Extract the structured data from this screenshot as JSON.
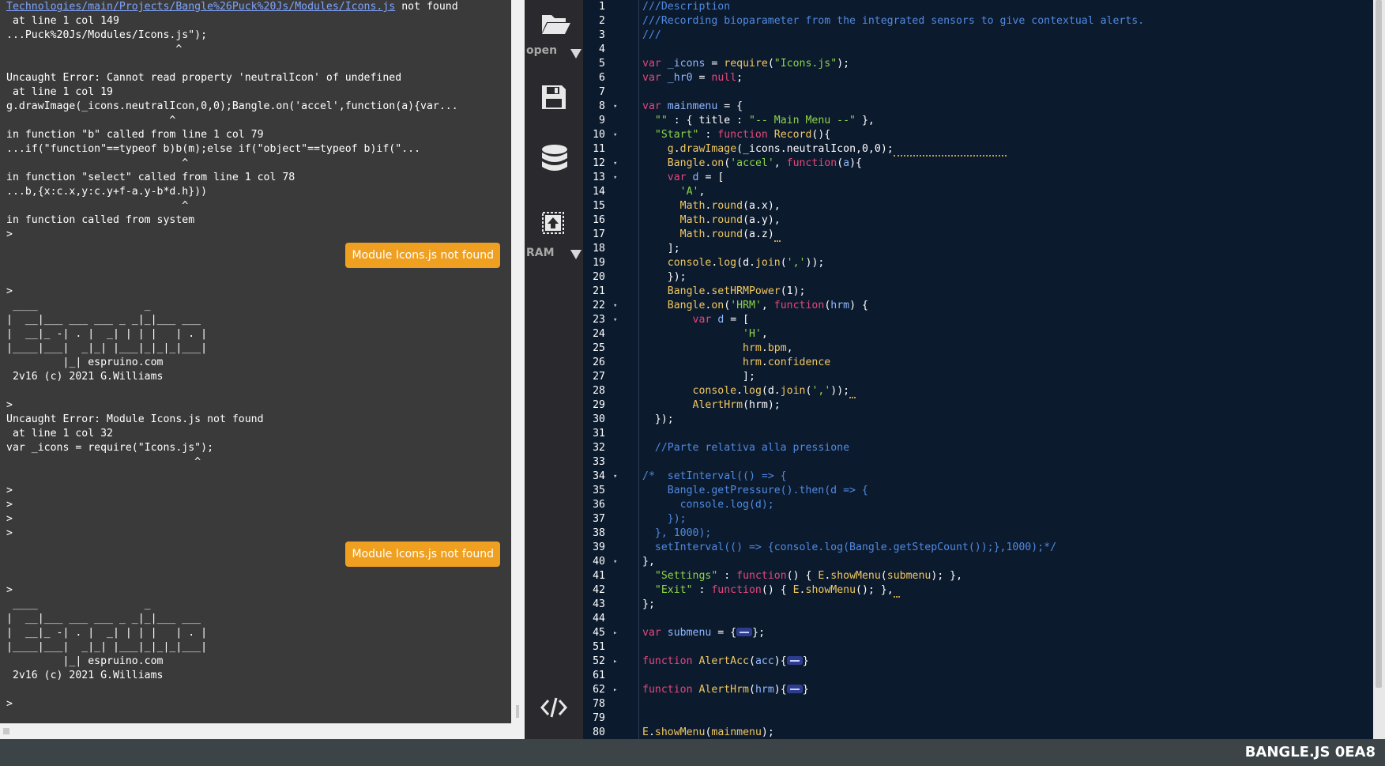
{
  "terminal": {
    "lines": [
      {
        "link": "Technologies/main/Projects/Bangle%26Puck%20Js/Modules/Icons.js",
        "text": " not found"
      },
      {
        "text": " at line 1 col 149"
      },
      {
        "text": "...Puck%20Js/Modules/Icons.js\");"
      },
      {
        "text": "                           ^"
      },
      {
        "text": ""
      },
      {
        "text": "Uncaught Error: Cannot read property 'neutralIcon' of undefined"
      },
      {
        "text": " at line 1 col 19"
      },
      {
        "text": "g.drawImage(_icons.neutralIcon,0,0);Bangle.on('accel',function(a){var..."
      },
      {
        "text": "                          ^"
      },
      {
        "text": "in function \"b\" called from line 1 col 79"
      },
      {
        "text": "...if(\"function\"==typeof b)b(m);else if(\"object\"==typeof b)if(\"..."
      },
      {
        "text": "                            ^"
      },
      {
        "text": "in function \"select\" called from line 1 col 78"
      },
      {
        "text": "...b,{x:c.x,y:c.y+f-a.y-b*d.h}))"
      },
      {
        "text": "                            ^"
      },
      {
        "text": "in function called from system"
      },
      {
        "text": ">"
      },
      {
        "badge": "Module Icons.js not found"
      },
      {
        "text": ""
      },
      {
        "text": ">"
      },
      {
        "text": " ____                 _"
      },
      {
        "text": "|  __|___ ___ ___ _ _|_|___ ___"
      },
      {
        "text": "|  __|_ -| . |  _| | | |   | . |"
      },
      {
        "text": "|____|___|  _|_| |___|_|_|_|___|"
      },
      {
        "text": "         |_| espruino.com"
      },
      {
        "text": " 2v16 (c) 2021 G.Williams"
      },
      {
        "text": ""
      },
      {
        "text": ">"
      },
      {
        "text": "Uncaught Error: Module Icons.js not found"
      },
      {
        "text": " at line 1 col 32"
      },
      {
        "text": "var _icons = require(\"Icons.js\");"
      },
      {
        "text": "                              ^"
      },
      {
        "text": ""
      },
      {
        "text": ">"
      },
      {
        "text": ">"
      },
      {
        "text": ">"
      },
      {
        "text": ">"
      },
      {
        "badge": "Module Icons.js not found"
      },
      {
        "text": ""
      },
      {
        "text": ">"
      },
      {
        "text": " ____                 _"
      },
      {
        "text": "|  __|___ ___ ___ _ _|_|___ ___"
      },
      {
        "text": "|  __|_ -| . |  _| | | |   | . |"
      },
      {
        "text": "|____|___|  _|_| |___|_|_|_|___|"
      },
      {
        "text": "         |_| espruino.com"
      },
      {
        "text": " 2v16 (c) 2021 G.Williams"
      },
      {
        "text": ""
      },
      {
        "text": ">"
      },
      {
        "text": ""
      },
      {
        "text": ">",
        "cursor": true
      }
    ]
  },
  "toolbar": {
    "open_label": "open",
    "ram_label": "RAM"
  },
  "editor": {
    "lines": [
      {
        "n": "1",
        "t": [
          [
            "cm",
            "///Description"
          ]
        ]
      },
      {
        "n": "2",
        "t": [
          [
            "cm",
            "///Recording bioparameter from the integrated sensors to give contextual alerts."
          ]
        ]
      },
      {
        "n": "3",
        "t": [
          [
            "cm",
            "///"
          ]
        ]
      },
      {
        "n": "4",
        "t": []
      },
      {
        "n": "5",
        "t": [
          [
            "kw",
            "var"
          ],
          [
            "pu",
            " "
          ],
          [
            "vr",
            "_icons"
          ],
          [
            "pu",
            " = "
          ],
          [
            "fn",
            "require"
          ],
          [
            "pu",
            "("
          ],
          [
            "st",
            "\"Icons.js\""
          ],
          [
            "pu",
            ");"
          ]
        ]
      },
      {
        "n": "6",
        "t": [
          [
            "kw",
            "var"
          ],
          [
            "pu",
            " "
          ],
          [
            "vr",
            "_hr0"
          ],
          [
            "pu",
            " = "
          ],
          [
            "kw",
            "null"
          ],
          [
            "pu",
            ";"
          ]
        ]
      },
      {
        "n": "7",
        "t": []
      },
      {
        "n": "8",
        "fold": true,
        "t": [
          [
            "kw",
            "var"
          ],
          [
            "pu",
            " "
          ],
          [
            "vr",
            "mainmenu"
          ],
          [
            "pu",
            " = {"
          ]
        ]
      },
      {
        "n": "9",
        "t": [
          [
            "pu",
            "  "
          ],
          [
            "st",
            "\"\""
          ],
          [
            "pu",
            " : { "
          ],
          [
            "pr",
            "title"
          ],
          [
            "pu",
            " : "
          ],
          [
            "st",
            "\"-- Main Menu --\""
          ],
          [
            "pu",
            " },"
          ]
        ]
      },
      {
        "n": "10",
        "fold": true,
        "t": [
          [
            "pu",
            "  "
          ],
          [
            "st",
            "\"Start\""
          ],
          [
            "pu",
            " : "
          ],
          [
            "kw",
            "function"
          ],
          [
            "pu",
            " "
          ],
          [
            "fn",
            "Record"
          ],
          [
            "pu",
            "(){"
          ]
        ]
      },
      {
        "n": "11",
        "t": [
          [
            "pu",
            "    "
          ],
          [
            "ob",
            "g"
          ],
          [
            "pu",
            "."
          ],
          [
            "fn",
            "drawImage"
          ],
          [
            "pu",
            "("
          ],
          [
            "pr",
            "_icons.neutralIcon"
          ],
          [
            "pu",
            ","
          ],
          [
            "nm",
            "0"
          ],
          [
            "pu",
            ","
          ],
          [
            "nm",
            "0"
          ],
          [
            "pu",
            ");"
          ],
          [
            "squig",
            "                  "
          ]
        ]
      },
      {
        "n": "12",
        "fold": true,
        "t": [
          [
            "pu",
            "    "
          ],
          [
            "ob",
            "Bangle"
          ],
          [
            "pu",
            "."
          ],
          [
            "fn",
            "on"
          ],
          [
            "pu",
            "("
          ],
          [
            "st",
            "'accel'"
          ],
          [
            "pu",
            ", "
          ],
          [
            "kw",
            "function"
          ],
          [
            "pu",
            "("
          ],
          [
            "vr",
            "a"
          ],
          [
            "pu",
            "){"
          ]
        ]
      },
      {
        "n": "13",
        "fold": true,
        "t": [
          [
            "pu",
            "    "
          ],
          [
            "kw",
            "var"
          ],
          [
            "pu",
            " "
          ],
          [
            "vr",
            "d"
          ],
          [
            "pu",
            " = ["
          ]
        ]
      },
      {
        "n": "14",
        "t": [
          [
            "pu",
            "      "
          ],
          [
            "st",
            "'A'"
          ],
          [
            "pu",
            ","
          ]
        ]
      },
      {
        "n": "15",
        "t": [
          [
            "pu",
            "      "
          ],
          [
            "ob",
            "Math"
          ],
          [
            "pu",
            "."
          ],
          [
            "fn",
            "round"
          ],
          [
            "pu",
            "(a.x),"
          ]
        ]
      },
      {
        "n": "16",
        "t": [
          [
            "pu",
            "      "
          ],
          [
            "ob",
            "Math"
          ],
          [
            "pu",
            "."
          ],
          [
            "fn",
            "round"
          ],
          [
            "pu",
            "(a.y),"
          ]
        ]
      },
      {
        "n": "17",
        "t": [
          [
            "pu",
            "      "
          ],
          [
            "ob",
            "Math"
          ],
          [
            "pu",
            "."
          ],
          [
            "fn",
            "round"
          ],
          [
            "pu",
            "(a.z)"
          ],
          [
            "squig",
            " "
          ]
        ]
      },
      {
        "n": "18",
        "t": [
          [
            "pu",
            "    ];"
          ]
        ]
      },
      {
        "n": "19",
        "t": [
          [
            "pu",
            "    "
          ],
          [
            "ob",
            "console"
          ],
          [
            "pu",
            "."
          ],
          [
            "fn",
            "log"
          ],
          [
            "pu",
            "(d."
          ],
          [
            "fn",
            "join"
          ],
          [
            "pu",
            "("
          ],
          [
            "st",
            "','"
          ],
          [
            "pu",
            "));"
          ]
        ]
      },
      {
        "n": "20",
        "t": [
          [
            "pu",
            "    });"
          ]
        ]
      },
      {
        "n": "21",
        "t": [
          [
            "pu",
            "    "
          ],
          [
            "ob",
            "Bangle"
          ],
          [
            "pu",
            "."
          ],
          [
            "fn",
            "setHRMPower"
          ],
          [
            "pu",
            "("
          ],
          [
            "nm",
            "1"
          ],
          [
            "pu",
            ");"
          ]
        ]
      },
      {
        "n": "22",
        "fold": true,
        "t": [
          [
            "pu",
            "    "
          ],
          [
            "ob",
            "Bangle"
          ],
          [
            "pu",
            "."
          ],
          [
            "fn",
            "on"
          ],
          [
            "pu",
            "("
          ],
          [
            "st",
            "'HRM'"
          ],
          [
            "pu",
            ", "
          ],
          [
            "kw",
            "function"
          ],
          [
            "pu",
            "("
          ],
          [
            "vr",
            "hrm"
          ],
          [
            "pu",
            ") {"
          ]
        ]
      },
      {
        "n": "23",
        "fold": true,
        "t": [
          [
            "pu",
            "        "
          ],
          [
            "kw",
            "var"
          ],
          [
            "pu",
            " "
          ],
          [
            "vr",
            "d"
          ],
          [
            "pu",
            " = ["
          ]
        ]
      },
      {
        "n": "24",
        "t": [
          [
            "pu",
            "                "
          ],
          [
            "st",
            "'H'"
          ],
          [
            "pu",
            ","
          ]
        ]
      },
      {
        "n": "25",
        "t": [
          [
            "pu",
            "                "
          ],
          [
            "fn",
            "hrm"
          ],
          [
            "pu",
            "."
          ],
          [
            "fn",
            "bpm"
          ],
          [
            "pu",
            ","
          ]
        ]
      },
      {
        "n": "26",
        "t": [
          [
            "pu",
            "                "
          ],
          [
            "fn",
            "hrm"
          ],
          [
            "pu",
            "."
          ],
          [
            "fn",
            "confidence"
          ]
        ]
      },
      {
        "n": "27",
        "t": [
          [
            "pu",
            "                ];"
          ]
        ]
      },
      {
        "n": "28",
        "t": [
          [
            "pu",
            "        "
          ],
          [
            "ob",
            "console"
          ],
          [
            "pu",
            "."
          ],
          [
            "fn",
            "log"
          ],
          [
            "pu",
            "(d."
          ],
          [
            "fn",
            "join"
          ],
          [
            "pu",
            "("
          ],
          [
            "st",
            "','"
          ],
          [
            "pu",
            "));"
          ],
          [
            "squig",
            " "
          ]
        ]
      },
      {
        "n": "29",
        "t": [
          [
            "pu",
            "        "
          ],
          [
            "fn",
            "AlertHrm"
          ],
          [
            "pu",
            "(hrm);"
          ]
        ]
      },
      {
        "n": "30",
        "t": [
          [
            "pu",
            "  });"
          ]
        ]
      },
      {
        "n": "31",
        "t": []
      },
      {
        "n": "32",
        "t": [
          [
            "pu",
            "  "
          ],
          [
            "cm",
            "//Parte relativa alla pressione"
          ]
        ]
      },
      {
        "n": "33",
        "t": []
      },
      {
        "n": "34",
        "fold": true,
        "t": [
          [
            "cm",
            "/*  setInterval(() => {"
          ]
        ]
      },
      {
        "n": "35",
        "t": [
          [
            "cm",
            "    Bangle.getPressure().then(d => {"
          ]
        ]
      },
      {
        "n": "36",
        "t": [
          [
            "cm",
            "      console.log(d);"
          ]
        ]
      },
      {
        "n": "37",
        "t": [
          [
            "cm",
            "    });"
          ]
        ]
      },
      {
        "n": "38",
        "t": [
          [
            "cm",
            "  }, 1000);"
          ]
        ]
      },
      {
        "n": "39",
        "t": [
          [
            "cm",
            "  setInterval(() => {console.log(Bangle.getStepCount());},1000);*/"
          ]
        ]
      },
      {
        "n": "40",
        "fold": true,
        "t": [
          [
            "pu",
            "},"
          ]
        ]
      },
      {
        "n": "41",
        "t": [
          [
            "pu",
            "  "
          ],
          [
            "st",
            "\"Settings\""
          ],
          [
            "pu",
            " : "
          ],
          [
            "kw",
            "function"
          ],
          [
            "pu",
            "() { "
          ],
          [
            "ob",
            "E"
          ],
          [
            "pu",
            "."
          ],
          [
            "fn",
            "showMenu"
          ],
          [
            "pu",
            "("
          ],
          [
            "fn",
            "submenu"
          ],
          [
            "pu",
            "); },"
          ]
        ]
      },
      {
        "n": "42",
        "t": [
          [
            "pu",
            "  "
          ],
          [
            "st",
            "\"Exit\""
          ],
          [
            "pu",
            " : "
          ],
          [
            "kw",
            "function"
          ],
          [
            "pu",
            "() { "
          ],
          [
            "ob",
            "E"
          ],
          [
            "pu",
            "."
          ],
          [
            "fn",
            "showMenu"
          ],
          [
            "pu",
            "(); },"
          ],
          [
            "squig",
            " "
          ]
        ]
      },
      {
        "n": "43",
        "t": [
          [
            "pu",
            "};"
          ]
        ]
      },
      {
        "n": "44",
        "t": []
      },
      {
        "n": "45",
        "collapsed": true,
        "t": [
          [
            "kw",
            "var"
          ],
          [
            "pu",
            " "
          ],
          [
            "vr",
            "submenu"
          ],
          [
            "pu",
            " = {"
          ],
          [
            "fold",
            ""
          ],
          [
            "pu",
            "};"
          ]
        ]
      },
      {
        "n": "51",
        "t": []
      },
      {
        "n": "52",
        "collapsed": true,
        "t": [
          [
            "kw",
            "function"
          ],
          [
            "pu",
            " "
          ],
          [
            "fn",
            "AlertAcc"
          ],
          [
            "pu",
            "("
          ],
          [
            "vr",
            "acc"
          ],
          [
            "pu",
            "){"
          ],
          [
            "fold",
            ""
          ],
          [
            "pu",
            "}"
          ]
        ]
      },
      {
        "n": "61",
        "t": []
      },
      {
        "n": "62",
        "collapsed": true,
        "t": [
          [
            "kw",
            "function"
          ],
          [
            "pu",
            " "
          ],
          [
            "fn",
            "AlertHrm"
          ],
          [
            "pu",
            "("
          ],
          [
            "vr",
            "hrm"
          ],
          [
            "pu",
            "){"
          ],
          [
            "fold",
            ""
          ],
          [
            "pu",
            "}"
          ]
        ]
      },
      {
        "n": "78",
        "t": []
      },
      {
        "n": "79",
        "t": []
      },
      {
        "n": "80",
        "t": [
          [
            "ob",
            "E"
          ],
          [
            "pu",
            "."
          ],
          [
            "fn",
            "showMenu"
          ],
          [
            "pu",
            "("
          ],
          [
            "fn",
            "mainmenu"
          ],
          [
            "pu",
            ");"
          ]
        ]
      }
    ]
  },
  "status": {
    "device": "BANGLE.JS 0EA8"
  }
}
